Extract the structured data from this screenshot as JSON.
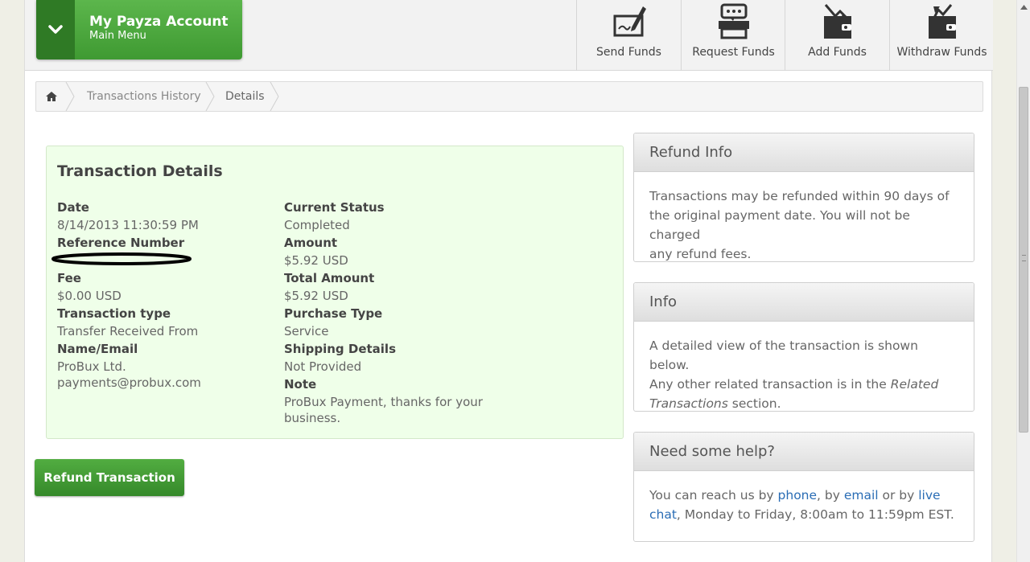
{
  "header": {
    "account_title": "My Payza Account",
    "account_subtitle": "Main Menu",
    "actions": [
      {
        "label": "Send Funds",
        "icon": "pen-check-icon"
      },
      {
        "label": "Request Funds",
        "icon": "printer-chat-icon"
      },
      {
        "label": "Add Funds",
        "icon": "wallet-add-icon"
      },
      {
        "label": "Withdraw Funds",
        "icon": "wallet-withdraw-icon"
      }
    ]
  },
  "breadcrumb": {
    "home_icon": "home-icon",
    "items": [
      "Transactions History",
      "Details"
    ]
  },
  "details": {
    "title": "Transaction Details",
    "left": {
      "date_label": "Date",
      "date_value": "8/14/2013 11:30:59 PM",
      "reference_label": "Reference Number",
      "fee_label": "Fee",
      "fee_value": "$0.00 USD",
      "type_label": "Transaction type",
      "type_value": "Transfer Received From",
      "name_label": "Name/Email",
      "name_value": "ProBux Ltd.",
      "email_value": "payments@probux.com"
    },
    "right": {
      "status_label": "Current Status",
      "status_value": "Completed",
      "amount_label": "Amount",
      "amount_value": "$5.92 USD",
      "total_label": "Total Amount",
      "total_value": "$5.92 USD",
      "purchase_label": "Purchase Type",
      "purchase_value": "Service",
      "shipping_label": "Shipping Details",
      "shipping_value": "Not Provided",
      "note_label": "Note",
      "note_line1": "ProBux Payment, thanks for your",
      "note_line2": "business."
    }
  },
  "refund_button": "Refund Transaction",
  "panels": {
    "refund": {
      "title": "Refund Info",
      "line1": "Transactions may be refunded within 90 days of",
      "line2": "the original payment date. You will not be charged",
      "line3": "any refund fees."
    },
    "info": {
      "title": "Info",
      "line1": "A detailed view of the transaction is shown below.",
      "line2_a": "Any other related transaction is in the ",
      "line2_em": "Related",
      "line3_em": "Transactions",
      "line3_b": " section."
    },
    "help": {
      "title": "Need some help?",
      "t1": "You can reach us by ",
      "link_phone": "phone",
      "t2": ", by ",
      "link_email": "email",
      "t3": " or by ",
      "link_live": "live",
      "link_chat": "chat",
      "t4": ", Monday to Friday, 8:00am to 11:59pm EST."
    }
  },
  "colors": {
    "brand_green": "#3f9a32",
    "details_bg": "#efffe9",
    "link": "#2a6db5"
  }
}
